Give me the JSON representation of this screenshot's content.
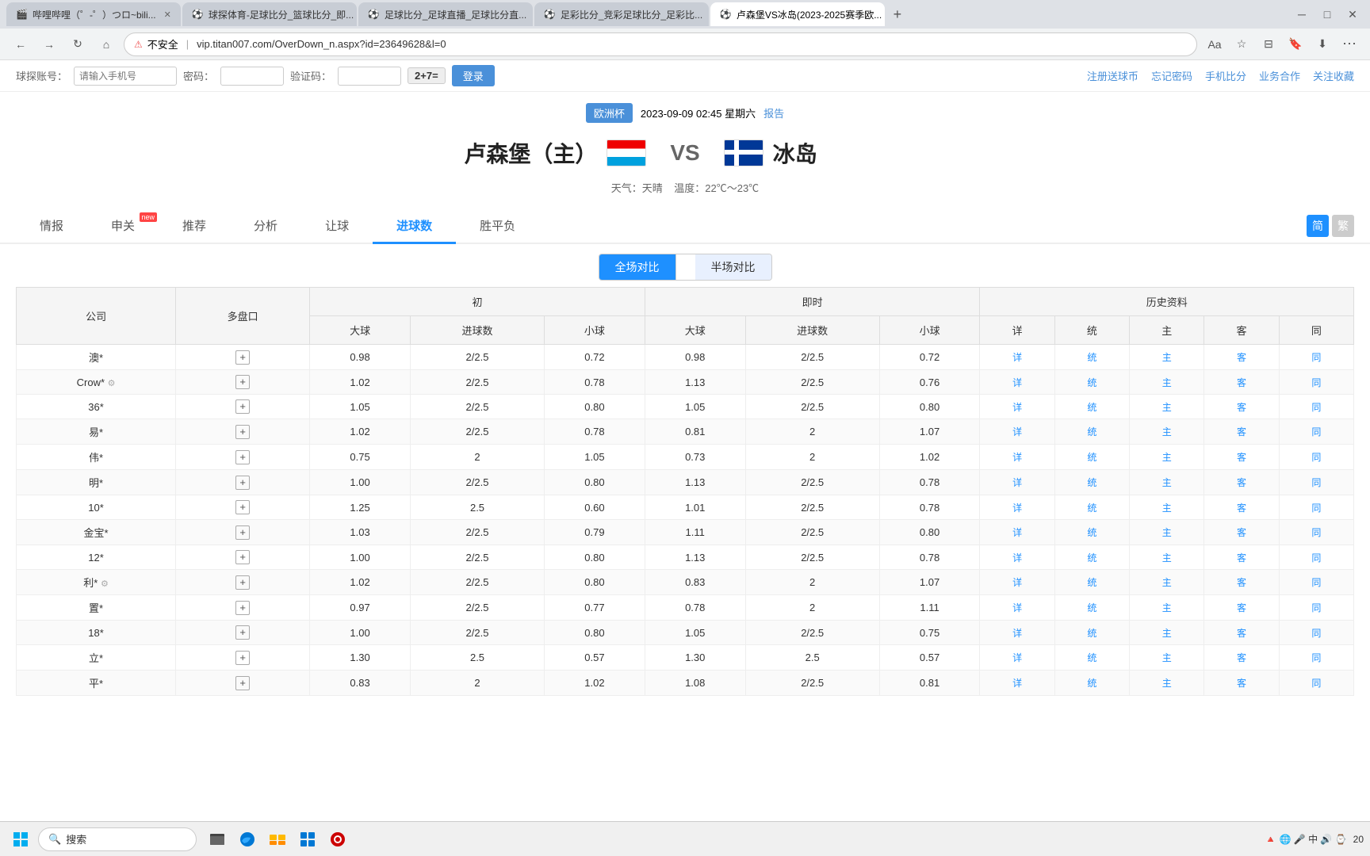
{
  "browser": {
    "tabs": [
      {
        "id": 1,
        "label": "哔哩哔哩（゜-゜）つロ~bili...",
        "active": false
      },
      {
        "id": 2,
        "label": "球探体育-足球比分_篮球比分_即...",
        "active": false
      },
      {
        "id": 3,
        "label": "足球比分_足球直播_足球比分直...",
        "active": false
      },
      {
        "id": 4,
        "label": "足彩比分_竞彩足球比分_足彩比...",
        "active": false
      },
      {
        "id": 5,
        "label": "卢森堡VS冰岛(2023-2025赛季欧...",
        "active": true
      }
    ],
    "url": "vip.titan007.com/OverDown_n.aspx?id=23649628&l=0",
    "warning_text": "不安全"
  },
  "login_bar": {
    "account_label": "球探账号：",
    "account_placeholder": "请输入手机号",
    "password_label": "密码：",
    "captcha_label": "验证码：",
    "captcha_display": "2+7=",
    "login_btn": "登录",
    "register_btn": "注册送球币",
    "forgot_btn": "忘记密码",
    "mobile_btn": "手机比分",
    "business_btn": "业务合作",
    "follow_btn": "关注收藏"
  },
  "match": {
    "league_badge": "欧洲杯",
    "date_text": "2023-09-09 02:45 星期六",
    "report_text": "报告",
    "team_home": "卢森堡（主）",
    "vs_text": "VS",
    "team_away": "冰岛",
    "weather_label": "天气：天晴",
    "temperature_label": "温度：22℃～23℃"
  },
  "nav_tabs": [
    {
      "id": "info",
      "label": "情报",
      "active": false,
      "new_badge": false
    },
    {
      "id": "shenguang",
      "label": "申关",
      "active": false,
      "new_badge": true
    },
    {
      "id": "recommend",
      "label": "推荐",
      "active": false,
      "new_badge": false
    },
    {
      "id": "analysis",
      "label": "分析",
      "active": false,
      "new_badge": false
    },
    {
      "id": "handicap",
      "label": "让球",
      "active": false,
      "new_badge": false
    },
    {
      "id": "goals",
      "label": "进球数",
      "active": true,
      "new_badge": false
    },
    {
      "id": "asian",
      "label": "胜平负",
      "active": false,
      "new_badge": false
    }
  ],
  "sub_tabs": [
    {
      "id": "full",
      "label": "全场对比",
      "active": true
    },
    {
      "id": "half",
      "label": "半场对比",
      "active": false
    }
  ],
  "table": {
    "headers": {
      "company": "公司",
      "spread": "多盘口",
      "initial_group": "初",
      "initial_sub": "进球数",
      "live_group": "即时",
      "live_sub": "进球数",
      "big_ball_initial": "大球",
      "small_ball_initial": "小球",
      "big_ball_live": "大球",
      "small_ball_live": "小球",
      "history": "历史资料"
    },
    "rows": [
      {
        "company": "澳*",
        "spread": "+",
        "big_initial": "0.98",
        "goals_initial": "2/2.5",
        "small_initial": "0.72",
        "big_live": "0.98",
        "goals_live": "2/2.5",
        "small_live": "0.72",
        "actions": [
          "详",
          "统",
          "主",
          "客",
          "同"
        ]
      },
      {
        "company": "Crow*",
        "spread": "+",
        "big_initial": "1.02",
        "goals_initial": "2/2.5",
        "small_initial": "0.78",
        "big_live": "1.13",
        "goals_live": "2/2.5",
        "small_live": "0.76",
        "actions": [
          "详",
          "统",
          "主",
          "客",
          "同"
        ],
        "has_icon": true
      },
      {
        "company": "36*",
        "spread": "+",
        "big_initial": "1.05",
        "goals_initial": "2/2.5",
        "small_initial": "0.80",
        "big_live": "1.05",
        "goals_live": "2/2.5",
        "small_live": "0.80",
        "actions": [
          "详",
          "统",
          "主",
          "客",
          "同"
        ]
      },
      {
        "company": "易*",
        "spread": "+",
        "big_initial": "1.02",
        "goals_initial": "2/2.5",
        "small_initial": "0.78",
        "big_live": "0.81",
        "goals_live": "2",
        "small_live": "1.07",
        "actions": [
          "详",
          "统",
          "主",
          "客",
          "同"
        ]
      },
      {
        "company": "伟*",
        "spread": "+",
        "big_initial": "0.75",
        "goals_initial": "2",
        "small_initial": "1.05",
        "big_live": "0.73",
        "goals_live": "2",
        "small_live": "1.02",
        "actions": [
          "详",
          "统",
          "主",
          "客",
          "同"
        ]
      },
      {
        "company": "明*",
        "spread": "+",
        "big_initial": "1.00",
        "goals_initial": "2/2.5",
        "small_initial": "0.80",
        "big_live": "1.13",
        "goals_live": "2/2.5",
        "small_live": "0.78",
        "actions": [
          "详",
          "统",
          "主",
          "客",
          "同"
        ]
      },
      {
        "company": "10*",
        "spread": "+",
        "big_initial": "1.25",
        "goals_initial": "2.5",
        "small_initial": "0.60",
        "big_live": "1.01",
        "goals_live": "2/2.5",
        "small_live": "0.78",
        "actions": [
          "详",
          "统",
          "主",
          "客",
          "同"
        ]
      },
      {
        "company": "金宝*",
        "spread": "+",
        "big_initial": "1.03",
        "goals_initial": "2/2.5",
        "small_initial": "0.79",
        "big_live": "1.11",
        "goals_live": "2/2.5",
        "small_live": "0.80",
        "actions": [
          "详",
          "统",
          "主",
          "客",
          "同"
        ]
      },
      {
        "company": "12*",
        "spread": "+",
        "big_initial": "1.00",
        "goals_initial": "2/2.5",
        "small_initial": "0.80",
        "big_live": "1.13",
        "goals_live": "2/2.5",
        "small_live": "0.78",
        "actions": [
          "详",
          "统",
          "主",
          "客",
          "同"
        ]
      },
      {
        "company": "利*",
        "spread": "+",
        "big_initial": "1.02",
        "goals_initial": "2/2.5",
        "small_initial": "0.80",
        "big_live": "0.83",
        "goals_live": "2",
        "small_live": "1.07",
        "actions": [
          "详",
          "统",
          "主",
          "客",
          "同"
        ],
        "has_icon": true
      },
      {
        "company": "置*",
        "spread": "+",
        "big_initial": "0.97",
        "goals_initial": "2/2.5",
        "small_initial": "0.77",
        "big_live": "0.78",
        "goals_live": "2",
        "small_live": "1.11",
        "actions": [
          "详",
          "统",
          "主",
          "客",
          "同"
        ]
      },
      {
        "company": "18*",
        "spread": "+",
        "big_initial": "1.00",
        "goals_initial": "2/2.5",
        "small_initial": "0.80",
        "big_live": "1.05",
        "goals_live": "2/2.5",
        "small_live": "0.75",
        "actions": [
          "详",
          "统",
          "主",
          "客",
          "同"
        ]
      },
      {
        "company": "立*",
        "spread": "+",
        "big_initial": "1.30",
        "goals_initial": "2.5",
        "small_initial": "0.57",
        "big_live": "1.30",
        "goals_live": "2.5",
        "small_live": "0.57",
        "actions": [
          "详",
          "统",
          "主",
          "客",
          "同"
        ]
      },
      {
        "company": "平*",
        "spread": "+",
        "big_initial": "0.83",
        "goals_initial": "2",
        "small_initial": "1.02",
        "big_live": "1.08",
        "goals_live": "2/2.5",
        "small_live": "0.81",
        "actions": [
          "详",
          "统",
          "主",
          "客",
          "同"
        ]
      }
    ]
  },
  "taskbar": {
    "search_placeholder": "搜索",
    "time": "20",
    "date": ""
  }
}
